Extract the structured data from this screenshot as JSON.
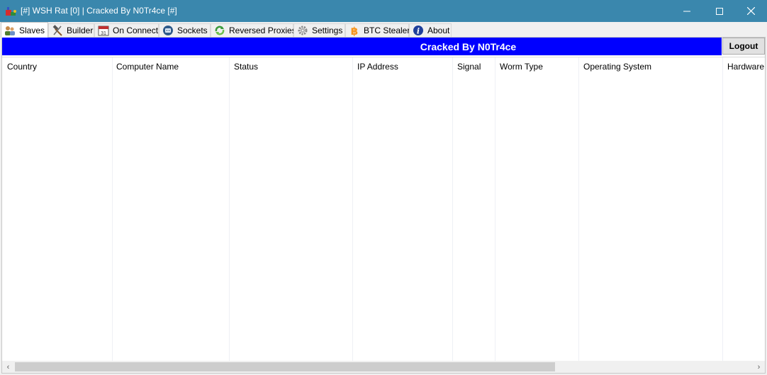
{
  "window": {
    "title": "[#] WSH Rat [0] | Cracked By N0Tr4ce [#]",
    "app_icon": "rat-app-icon",
    "controls": {
      "minimize": "minimize-icon",
      "maximize": "maximize-icon",
      "close": "close-icon"
    },
    "titlebar_color": "#3a87ad"
  },
  "tabs": [
    {
      "label": "Slaves",
      "icon": "users-icon",
      "active": true
    },
    {
      "label": "Builder",
      "icon": "hammer-icon",
      "active": false
    },
    {
      "label": "On Connect",
      "icon": "calendar-icon",
      "active": false
    },
    {
      "label": "Sockets",
      "icon": "socket-icon",
      "active": false
    },
    {
      "label": "Reversed Proxies",
      "icon": "recycle-icon",
      "active": false
    },
    {
      "label": "Settings",
      "icon": "gear-icon",
      "active": false
    },
    {
      "label": "BTC Stealer",
      "icon": "bitcoin-icon",
      "active": false
    },
    {
      "label": "About",
      "icon": "info-icon",
      "active": false
    }
  ],
  "banner": {
    "text": "Cracked By N0Tr4ce",
    "color": "#0000ff"
  },
  "logout_label": "Logout",
  "table": {
    "columns": [
      "Country",
      "Computer Name",
      "Status",
      "IP Address",
      "Signal",
      "Worm Type",
      "Operating System",
      "Hardware I"
    ],
    "rows": []
  },
  "scrollbar": {
    "left_arrow": "‹",
    "right_arrow": "›"
  }
}
